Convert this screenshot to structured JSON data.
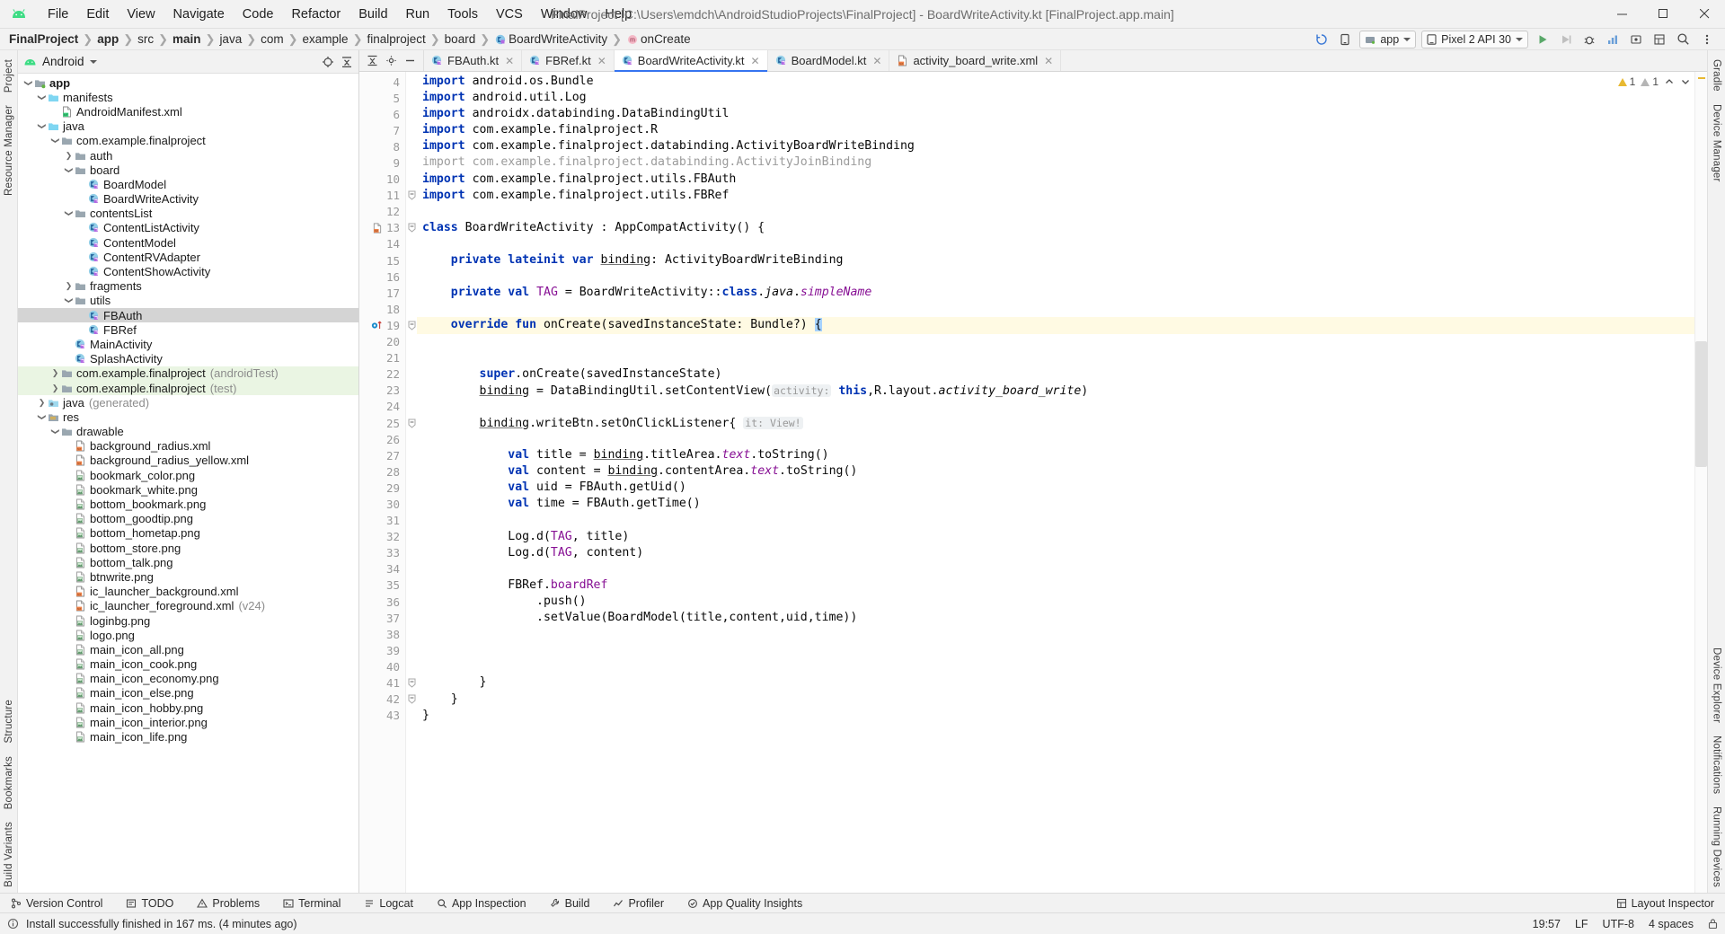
{
  "window": {
    "title": "FinalProject [C:\\Users\\emdch\\AndroidStudioProjects\\FinalProject] - BoardWriteActivity.kt [FinalProject.app.main]",
    "minimize": "—",
    "maximize": "▭",
    "close": "✕"
  },
  "menu": [
    "File",
    "Edit",
    "View",
    "Navigate",
    "Code",
    "Refactor",
    "Build",
    "Run",
    "Tools",
    "VCS",
    "Window",
    "Help"
  ],
  "breadcrumb": [
    {
      "label": "FinalProject",
      "bold": true,
      "icon": ""
    },
    {
      "label": "app",
      "bold": true,
      "icon": ""
    },
    {
      "label": "src",
      "bold": false,
      "icon": ""
    },
    {
      "label": "main",
      "bold": true,
      "icon": ""
    },
    {
      "label": "java",
      "bold": false,
      "icon": ""
    },
    {
      "label": "com",
      "bold": false,
      "icon": ""
    },
    {
      "label": "example",
      "bold": false,
      "icon": ""
    },
    {
      "label": "finalproject",
      "bold": false,
      "icon": ""
    },
    {
      "label": "board",
      "bold": false,
      "icon": ""
    },
    {
      "label": "BoardWriteActivity",
      "bold": false,
      "icon": "kotlin-class-icon"
    },
    {
      "label": "onCreate",
      "bold": false,
      "icon": "method-icon"
    }
  ],
  "nav_right": {
    "app_config": "app",
    "device": "Pixel 2 API 30",
    "run_icon": "run-icon",
    "debug_icon": "debug-icon",
    "search_icon": "search-icon",
    "more_icon": "more-icon"
  },
  "left_strip": [
    "Project",
    "Resource Manager"
  ],
  "left_strip_bottom": [
    "Structure",
    "Bookmarks",
    "Build Variants"
  ],
  "right_strip": [
    "Gradle",
    "Device Manager"
  ],
  "right_strip_bottom": [
    "Device Explorer",
    "Notifications",
    "Running Devices"
  ],
  "project_panel": {
    "view": "Android",
    "dropdown_icon": "chevron-down-icon",
    "locate_icon": "target-icon",
    "collapse_icon": "collapse-all-icon",
    "settings_icon": "gear-icon",
    "hide_icon": "hide-icon",
    "tree": [
      {
        "depth": 0,
        "arrow": "v",
        "icon": "module-icon",
        "label": "app",
        "bold": true
      },
      {
        "depth": 1,
        "arrow": "v",
        "icon": "folder-blue",
        "label": "manifests"
      },
      {
        "depth": 2,
        "arrow": "",
        "icon": "manifest-file",
        "label": "AndroidManifest.xml"
      },
      {
        "depth": 1,
        "arrow": "v",
        "icon": "folder-blue",
        "label": "java"
      },
      {
        "depth": 2,
        "arrow": "v",
        "icon": "package-icon",
        "label": "com.example.finalproject"
      },
      {
        "depth": 3,
        "arrow": ">",
        "icon": "package-icon",
        "label": "auth"
      },
      {
        "depth": 3,
        "arrow": "v",
        "icon": "package-icon",
        "label": "board"
      },
      {
        "depth": 4,
        "arrow": "",
        "icon": "kotlin-class",
        "label": "BoardModel"
      },
      {
        "depth": 4,
        "arrow": "",
        "icon": "kotlin-class",
        "label": "BoardWriteActivity"
      },
      {
        "depth": 3,
        "arrow": "v",
        "icon": "package-icon",
        "label": "contentsList"
      },
      {
        "depth": 4,
        "arrow": "",
        "icon": "kotlin-class",
        "label": "ContentListActivity"
      },
      {
        "depth": 4,
        "arrow": "",
        "icon": "kotlin-class",
        "label": "ContentModel"
      },
      {
        "depth": 4,
        "arrow": "",
        "icon": "kotlin-class",
        "label": "ContentRVAdapter"
      },
      {
        "depth": 4,
        "arrow": "",
        "icon": "kotlin-class",
        "label": "ContentShowActivity"
      },
      {
        "depth": 3,
        "arrow": ">",
        "icon": "package-icon",
        "label": "fragments"
      },
      {
        "depth": 3,
        "arrow": "v",
        "icon": "package-icon",
        "label": "utils"
      },
      {
        "depth": 4,
        "arrow": "",
        "icon": "kotlin-class",
        "label": "FBAuth",
        "selected": true
      },
      {
        "depth": 4,
        "arrow": "",
        "icon": "kotlin-class",
        "label": "FBRef"
      },
      {
        "depth": 3,
        "arrow": "",
        "icon": "kotlin-class",
        "label": "MainActivity"
      },
      {
        "depth": 3,
        "arrow": "",
        "icon": "kotlin-class",
        "label": "SplashActivity"
      },
      {
        "depth": 2,
        "arrow": ">",
        "icon": "package-icon",
        "label": "com.example.finalproject",
        "dim": "(androidTest)",
        "test": true
      },
      {
        "depth": 2,
        "arrow": ">",
        "icon": "package-icon",
        "label": "com.example.finalproject",
        "dim": "(test)",
        "test": true
      },
      {
        "depth": 1,
        "arrow": ">",
        "icon": "folder-gen",
        "label": "java",
        "dim": "(generated)"
      },
      {
        "depth": 1,
        "arrow": "v",
        "icon": "folder-res",
        "label": "res"
      },
      {
        "depth": 2,
        "arrow": "v",
        "icon": "package-icon",
        "label": "drawable"
      },
      {
        "depth": 3,
        "arrow": "",
        "icon": "xml-file",
        "label": "background_radius.xml"
      },
      {
        "depth": 3,
        "arrow": "",
        "icon": "xml-file",
        "label": "background_radius_yellow.xml"
      },
      {
        "depth": 3,
        "arrow": "",
        "icon": "png-file",
        "label": "bookmark_color.png"
      },
      {
        "depth": 3,
        "arrow": "",
        "icon": "png-file",
        "label": "bookmark_white.png"
      },
      {
        "depth": 3,
        "arrow": "",
        "icon": "png-file",
        "label": "bottom_bookmark.png"
      },
      {
        "depth": 3,
        "arrow": "",
        "icon": "png-file",
        "label": "bottom_goodtip.png"
      },
      {
        "depth": 3,
        "arrow": "",
        "icon": "png-file",
        "label": "bottom_hometap.png"
      },
      {
        "depth": 3,
        "arrow": "",
        "icon": "png-file",
        "label": "bottom_store.png"
      },
      {
        "depth": 3,
        "arrow": "",
        "icon": "png-file",
        "label": "bottom_talk.png"
      },
      {
        "depth": 3,
        "arrow": "",
        "icon": "png-file",
        "label": "btnwrite.png"
      },
      {
        "depth": 3,
        "arrow": "",
        "icon": "xml-file",
        "label": "ic_launcher_background.xml"
      },
      {
        "depth": 3,
        "arrow": "",
        "icon": "xml-file",
        "label": "ic_launcher_foreground.xml",
        "dim": "(v24)"
      },
      {
        "depth": 3,
        "arrow": "",
        "icon": "png-file",
        "label": "loginbg.png"
      },
      {
        "depth": 3,
        "arrow": "",
        "icon": "png-file",
        "label": "logo.png"
      },
      {
        "depth": 3,
        "arrow": "",
        "icon": "png-file",
        "label": "main_icon_all.png"
      },
      {
        "depth": 3,
        "arrow": "",
        "icon": "png-file",
        "label": "main_icon_cook.png"
      },
      {
        "depth": 3,
        "arrow": "",
        "icon": "png-file",
        "label": "main_icon_economy.png"
      },
      {
        "depth": 3,
        "arrow": "",
        "icon": "png-file",
        "label": "main_icon_else.png"
      },
      {
        "depth": 3,
        "arrow": "",
        "icon": "png-file",
        "label": "main_icon_hobby.png"
      },
      {
        "depth": 3,
        "arrow": "",
        "icon": "png-file",
        "label": "main_icon_interior.png"
      },
      {
        "depth": 3,
        "arrow": "",
        "icon": "png-file",
        "label": "main_icon_life.png"
      }
    ]
  },
  "editor_tabs": [
    {
      "label": "FBAuth.kt",
      "icon": "kotlin-class",
      "active": false
    },
    {
      "label": "FBRef.kt",
      "icon": "kotlin-class",
      "active": false
    },
    {
      "label": "BoardWriteActivity.kt",
      "icon": "kotlin-class",
      "active": true
    },
    {
      "label": "BoardModel.kt",
      "icon": "kotlin-class",
      "active": false
    },
    {
      "label": "activity_board_write.xml",
      "icon": "xml-file",
      "active": false
    }
  ],
  "inspection": {
    "warnings": "1",
    "weak_warnings": "1",
    "up_icon": "chevron-up-icon",
    "down_icon": "chevron-down-icon"
  },
  "code": {
    "first_line": 4,
    "lines": [
      {
        "n": 4,
        "html": "<span class=\"kw\">import</span> android.os.Bundle"
      },
      {
        "n": 5,
        "html": "<span class=\"kw\">import</span> android.util.Log"
      },
      {
        "n": 6,
        "html": "<span class=\"kw\">import</span> androidx.databinding.DataBindingUtil"
      },
      {
        "n": 7,
        "html": "<span class=\"kw\">import</span> com.example.finalproject.R"
      },
      {
        "n": 8,
        "html": "<span class=\"kw\">import</span> com.example.finalproject.databinding.ActivityBoardWriteBinding"
      },
      {
        "n": 9,
        "html": "<span class=\"dim2\">import com.example.finalproject.databinding.ActivityJoinBinding</span>"
      },
      {
        "n": 10,
        "html": "<span class=\"kw\">import</span> com.example.finalproject.utils.FBAuth"
      },
      {
        "n": 11,
        "html": "<span class=\"kw\">import</span> com.example.finalproject.utils.FBRef",
        "fold": "-"
      },
      {
        "n": 12,
        "html": ""
      },
      {
        "n": 13,
        "html": "<span class=\"kw\">class</span> BoardWriteActivity : AppCompatActivity() {",
        "fold": "-",
        "gutter_icon": "layout-resource-icon"
      },
      {
        "n": 14,
        "html": ""
      },
      {
        "n": 15,
        "html": "    <span class=\"kw\">private lateinit var</span> <span class=\"uline\">binding</span>: ActivityBoardWriteBinding"
      },
      {
        "n": 16,
        "html": ""
      },
      {
        "n": 17,
        "html": "    <span class=\"kw\">private val</span> <span class=\"field\">TAG</span> = BoardWriteActivity::<span class=\"kw\">class</span>.<span class=\"it2\">java</span>.<span class=\"it\">simpleName</span>"
      },
      {
        "n": 18,
        "html": ""
      },
      {
        "n": 19,
        "html": "    <span class=\"kw\">override fun</span> onCreate(savedInstanceState: Bundle?) <span class=\"selbrace\">{</span>",
        "caret": true,
        "fold": "-",
        "gutter_icon": "override-icon"
      },
      {
        "n": 20,
        "html": ""
      },
      {
        "n": 21,
        "html": ""
      },
      {
        "n": 22,
        "html": "        <span class=\"kw\">super</span>.onCreate(savedInstanceState)"
      },
      {
        "n": 23,
        "html": "        <span class=\"uline\">binding</span> = DataBindingUtil.setContentView(<span class=\"hint\">activity:</span> <span class=\"kw\">this</span>,R.layout.<span class=\"it2\">activity_board_write</span>)"
      },
      {
        "n": 24,
        "html": ""
      },
      {
        "n": 25,
        "html": "        <span class=\"uline\">binding</span>.writeBtn.setOnClickListener{ <span class=\"hint\">it: View!</span>",
        "fold": "-"
      },
      {
        "n": 26,
        "html": ""
      },
      {
        "n": 27,
        "html": "            <span class=\"kw\">val</span> title = <span class=\"uline\">binding</span>.titleArea.<span class=\"it\">text</span>.toString()"
      },
      {
        "n": 28,
        "html": "            <span class=\"kw\">val</span> content = <span class=\"uline\">binding</span>.contentArea.<span class=\"it\">text</span>.toString()"
      },
      {
        "n": 29,
        "html": "            <span class=\"kw\">val</span> uid = FBAuth.getUid()"
      },
      {
        "n": 30,
        "html": "            <span class=\"kw\">val</span> time = FBAuth.getTime()"
      },
      {
        "n": 31,
        "html": ""
      },
      {
        "n": 32,
        "html": "            Log.d(<span class=\"field\">TAG</span>, title)"
      },
      {
        "n": 33,
        "html": "            Log.d(<span class=\"field\">TAG</span>, content)"
      },
      {
        "n": 34,
        "html": ""
      },
      {
        "n": 35,
        "html": "            FBRef.<span class=\"field\">boardRef</span>"
      },
      {
        "n": 36,
        "html": "                .push()"
      },
      {
        "n": 37,
        "html": "                .setValue(BoardModel(title,content,uid,time))"
      },
      {
        "n": 38,
        "html": ""
      },
      {
        "n": 39,
        "html": ""
      },
      {
        "n": 40,
        "html": ""
      },
      {
        "n": 41,
        "html": "        }",
        "fold": "-"
      },
      {
        "n": 42,
        "html": "    }",
        "fold": "-"
      },
      {
        "n": 43,
        "html": "}"
      }
    ]
  },
  "bottom_toolbar": [
    {
      "label": "Version Control",
      "icon": "vcs-icon"
    },
    {
      "label": "TODO",
      "icon": "todo-icon"
    },
    {
      "label": "Problems",
      "icon": "problems-icon"
    },
    {
      "label": "Terminal",
      "icon": "terminal-icon"
    },
    {
      "label": "Logcat",
      "icon": "logcat-icon"
    },
    {
      "label": "App Inspection",
      "icon": "inspection-icon"
    },
    {
      "label": "Build",
      "icon": "build-icon"
    },
    {
      "label": "Profiler",
      "icon": "profiler-icon"
    },
    {
      "label": "App Quality Insights",
      "icon": "quality-icon"
    }
  ],
  "bottom_toolbar_right": [
    {
      "label": "Layout Inspector",
      "icon": "layout-inspector-icon"
    }
  ],
  "statusbar": {
    "message": "Install successfully finished in 167 ms. (4 minutes ago)",
    "info_icon": "info-icon",
    "caret_position": "19:57",
    "line_separator": "LF",
    "encoding": "UTF-8",
    "indent": "4 spaces",
    "lock_icon": "lock-icon"
  }
}
